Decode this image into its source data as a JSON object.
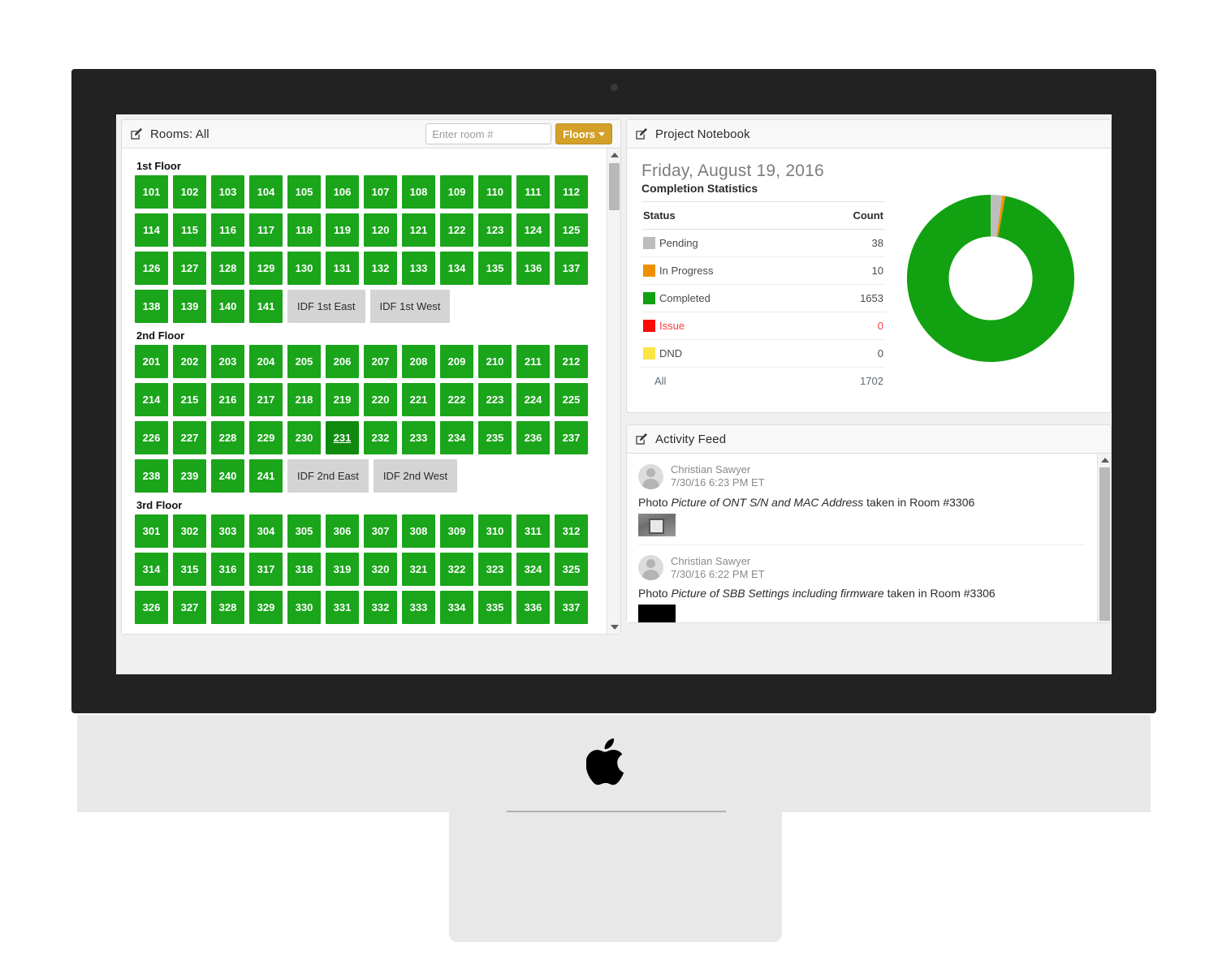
{
  "rooms_panel": {
    "title": "Rooms: All",
    "title_icon": "edit-pencil-square-icon",
    "search": {
      "placeholder": "Enter room #",
      "value": ""
    },
    "floors_button": "Floors",
    "floors_caret": "chevron-down-icon",
    "floors": [
      {
        "label": "1st Floor",
        "rows": [
          [
            "101",
            "102",
            "103",
            "104",
            "105",
            "106",
            "107",
            "108",
            "109",
            "110",
            "111",
            "112"
          ],
          [
            "114",
            "115",
            "116",
            "117",
            "118",
            "119",
            "120",
            "121",
            "122",
            "123",
            "124",
            "125"
          ],
          [
            "126",
            "127",
            "128",
            "129",
            "130",
            "131",
            "132",
            "133",
            "134",
            "135",
            "136",
            "137"
          ],
          [
            "138",
            "139",
            "140",
            "141"
          ]
        ],
        "idf": [
          "IDF 1st East",
          "IDF 1st West"
        ]
      },
      {
        "label": "2nd Floor",
        "rows": [
          [
            "201",
            "202",
            "203",
            "204",
            "205",
            "206",
            "207",
            "208",
            "209",
            "210",
            "211",
            "212"
          ],
          [
            "214",
            "215",
            "216",
            "217",
            "218",
            "219",
            "220",
            "221",
            "222",
            "223",
            "224",
            "225"
          ],
          [
            "226",
            "227",
            "228",
            "229",
            "230",
            "231",
            "232",
            "233",
            "234",
            "235",
            "236",
            "237"
          ],
          [
            "238",
            "239",
            "240",
            "241"
          ]
        ],
        "idf": [
          "IDF 2nd East",
          "IDF 2nd West"
        ]
      },
      {
        "label": "3rd Floor",
        "rows": [
          [
            "301",
            "302",
            "303",
            "304",
            "305",
            "306",
            "307",
            "308",
            "309",
            "310",
            "311",
            "312"
          ],
          [
            "314",
            "315",
            "316",
            "317",
            "318",
            "319",
            "320",
            "321",
            "322",
            "323",
            "324",
            "325"
          ],
          [
            "326",
            "327",
            "328",
            "329",
            "330",
            "331",
            "332",
            "333",
            "334",
            "335",
            "336",
            "337"
          ]
        ],
        "idf": []
      }
    ],
    "active_room": "231",
    "room_color": "#1aa51a",
    "room_active_color": "#0e8a0e",
    "idf_color": "#d4d4d4"
  },
  "notebook": {
    "title": "Project Notebook",
    "title_icon": "edit-pencil-square-icon",
    "date": "Friday, August 19, 2016",
    "subtitle": "Completion Statistics",
    "columns": {
      "status": "Status",
      "count": "Count"
    },
    "rows": [
      {
        "label": "Pending",
        "count": "38",
        "color": "#bdbdbd",
        "text_color": "#4a4a4a"
      },
      {
        "label": "In Progress",
        "count": "10",
        "color": "#ef9000",
        "text_color": "#4a4a4a"
      },
      {
        "label": "Completed",
        "count": "1653",
        "color": "#11a111",
        "text_color": "#4a4a4a"
      },
      {
        "label": "Issue",
        "count": "0",
        "color": "#fb0a0a",
        "text_color": "#fb3b3b"
      },
      {
        "label": "DND",
        "count": "0",
        "color": "#fae546",
        "text_color": "#4a4a4a"
      }
    ],
    "total": {
      "label": "All",
      "count": "1702"
    }
  },
  "chart_data": {
    "type": "pie",
    "title": "Completion Statistics",
    "donut": true,
    "inner_radius_ratio": 0.5,
    "labels": [
      "Pending",
      "In Progress",
      "Completed",
      "Issue",
      "DND"
    ],
    "values": [
      38,
      10,
      1653,
      0,
      0
    ],
    "total": 1702,
    "colors": [
      "#bdbdbd",
      "#ef9000",
      "#11a111",
      "#fb0a0a",
      "#fae546"
    ],
    "legend": "table-left",
    "start_angle_deg": 0
  },
  "activity_feed": {
    "title": "Activity Feed",
    "title_icon": "edit-pencil-square-icon",
    "items": [
      {
        "author": "Christian Sawyer",
        "timestamp": "7/30/16 6:23 PM ET",
        "prefix": "Photo ",
        "subject": "Picture of ONT S/N and MAC Address",
        "suffix": " taken in Room #3306",
        "thumbnail": "photo-thumbnail-ont-label"
      },
      {
        "author": "Christian Sawyer",
        "timestamp": "7/30/16 6:22 PM ET",
        "prefix": "Photo ",
        "subject": "Picture of SBB Settings including firmware",
        "suffix": " taken in Room #3306",
        "thumbnail": "photo-thumbnail-sbb-screen"
      }
    ]
  },
  "device": {
    "brand_logo": "apple-logo",
    "camera": "webcam-dot",
    "bezel_color": "#222222",
    "chin_color": "#e8e8e8"
  }
}
